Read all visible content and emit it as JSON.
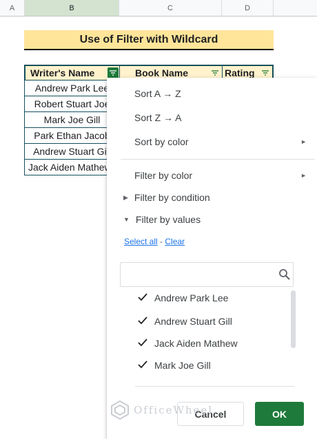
{
  "columns": [
    "A",
    "B",
    "C",
    "D"
  ],
  "title": "Use of Filter with Wildcard",
  "table": {
    "headers": [
      "Writer's Name",
      "Book Name",
      "Rating"
    ],
    "rows": [
      "Andrew Park Lee",
      "Robert Stuart Joe",
      "Mark Joe Gill",
      "Park Ethan Jacob",
      "Andrew Stuart Gill",
      "Jack Aiden Mathew"
    ]
  },
  "menu": {
    "sort_az": "Sort A → Z",
    "sort_za": "Sort Z → A",
    "sort_color": "Sort by color",
    "filter_color": "Filter by color",
    "filter_condition": "Filter by condition",
    "filter_values": "Filter by values",
    "select_all": "Select all",
    "separator": " - ",
    "clear": "Clear",
    "search_placeholder": "",
    "values": [
      "Andrew Park Lee",
      "Andrew Stuart Gill",
      "Jack Aiden Mathew",
      "Mark Joe Gill"
    ],
    "cancel": "Cancel",
    "ok": "OK"
  },
  "watermark": "OfficeWheel",
  "colors": {
    "ok_green": "#1e7a3a",
    "title_fill": "#ffe599",
    "header_fill": "#fff2cc",
    "link_blue": "#1a73e8"
  }
}
